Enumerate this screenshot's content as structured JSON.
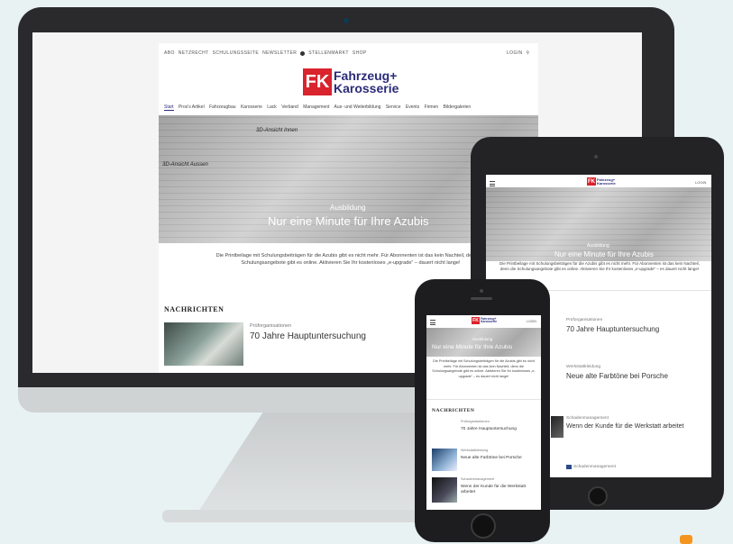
{
  "desktop": {
    "topnav": [
      "ABO",
      "NETZRECHT",
      "SCHULUNGSSEITE",
      "NEWSLETTER",
      "STELLENMARKT",
      "SHOP"
    ],
    "login": "LOGIN",
    "logo_mark": "FK",
    "logo_line1": "Fahrzeug+",
    "logo_line2": "Karosserie",
    "mainnav": [
      "Start",
      "Pros's Artikel",
      "Fahrzeugbau",
      "Karosserie",
      "Lack",
      "Verband",
      "Management",
      "Aus- und Weiterbildung",
      "Service",
      "Events",
      "Firmen",
      "Bildergalerien"
    ],
    "hero_label_left": "3D-Ansicht Aussen",
    "hero_label_mid": "3D-Ansicht Innen",
    "hero_sub": "Ausbildung",
    "hero_title": "Nur eine Minute für Ihre Azubis",
    "teaser": "Die Printbeilage mit Schulungsbeiträgen für die Azubis gibt es nicht mehr. Für Abonnenten ist das kein Nachteil, denn die Schulungsangebote gibt es online. Aktivieren Sie Ihr kostenloses „e-upgrade“ – dauert nicht lange!",
    "news_heading": "NACHRICHTEN",
    "news": [
      {
        "kicker": "Prüforganisationen",
        "headline": "70 Jahre Hauptuntersuchung"
      }
    ]
  },
  "tablet": {
    "login": "LOGIN",
    "logo_mark": "FK",
    "logo_text": "Fahrzeug+ Karosserie",
    "hero_sub": "Ausbildung",
    "hero_title": "Nur eine Minute für Ihre Azubis",
    "teaser": "Die Printbeilage mit Schulungsbeiträgen für die Azubis gibt es nicht mehr. Für Abonnenten ist das kein Nachteil, denn die Schulungsangebote gibt es online. Aktivieren Sie Ihr kostenloses „e-upgrade“ – es dauert nicht lange!",
    "news": [
      {
        "kicker": "Prüforganisationen",
        "headline": "70 Jahre Hauptuntersuchung"
      },
      {
        "kicker": "Werkstattkleidung",
        "headline": "Neue alte Farbtöne bei Porsche"
      },
      {
        "kicker": "Schadenmanagement",
        "headline": "Wenn der Kunde für die Werkstatt arbeitet"
      },
      {
        "kicker": "Schadenmanagement",
        "headline": ""
      }
    ]
  },
  "phone": {
    "login": "LOGIN",
    "logo_mark": "FK",
    "logo_text": "Fahrzeug+ Karosserie",
    "hero_sub": "Ausbildung",
    "hero_title": "Nur eine Minute für Ihre Azubis",
    "teaser": "Die Printbeilage mit Schulungsbeiträgen für die Azubis gibt es nicht mehr. Für Abonnenten ist das kein Nachteil, denn die Schulungsangebote gibt es online. Aktivieren Sie Ihr kostenloses „e-upgrade“ – es dauert nicht lange!",
    "news_heading": "NACHRICHTEN",
    "news": [
      {
        "kicker": "Prüforganisationen",
        "headline": "70 Jahre Hauptuntersuchung"
      },
      {
        "kicker": "Werkstattkleidung",
        "headline": "Neue alte Farbtöne bei Porsche"
      },
      {
        "kicker": "Schadenmanagement",
        "headline": "Wenn der Kunde für die Werkstatt arbeitet"
      }
    ]
  },
  "colors": {
    "brand_red": "#d9232d",
    "brand_blue": "#2b2b7a",
    "accent_orange": "#f4951f"
  }
}
